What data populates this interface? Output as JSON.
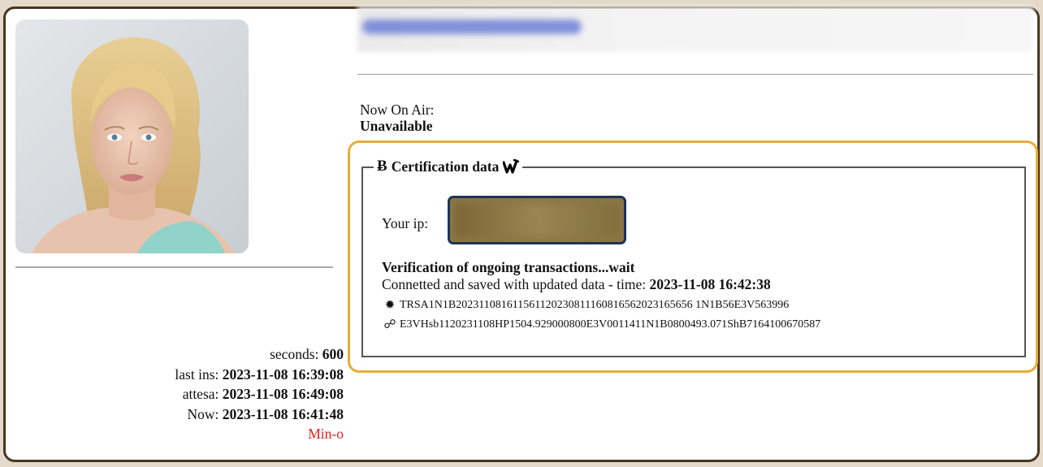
{
  "profile": {
    "photo_icon": "woman-portrait"
  },
  "header": {
    "blurred_link": ""
  },
  "on_air": {
    "label": "Now On Air:",
    "value": "Unavailable"
  },
  "certification": {
    "legend_prefix_icon": "bitcoin-icon",
    "legend_prefix_glyph": "Ƀ",
    "legend": "Certification data",
    "legend_suffix_icon": "brand-w-icon",
    "ip_label": "Your ip:",
    "ip_value": "",
    "status_title": "Verification of ongoing transactions...wait",
    "status_prefix": "Connetted and saved with updated data - time: ",
    "status_time": "2023-11-08 16:42:38",
    "code1_icon": "gear-icon",
    "code1_glyph": "✹",
    "code1": "TRSA1N1B202311081611561120230811160816562023165656 1N1B56E3V563996",
    "code2_icon": "link-icon",
    "code2_glyph": "☍",
    "code2": "E3VHsb1120231108HP1504.929000800E3V0011411N1B0800493.071ShB7164100670587"
  },
  "stats": {
    "seconds_label": "seconds: ",
    "seconds_value": "600",
    "last_ins_label": "last ins: ",
    "last_ins_value": "2023-11-08 16:39:08",
    "attesa_label": "attesa: ",
    "attesa_value": "2023-11-08 16:49:08",
    "now_label": "Now: ",
    "now_value": "2023-11-08 16:41:48",
    "mode": "Min-o",
    "mode_color": "#e8211f"
  },
  "colors": {
    "frame_border": "#4a3520",
    "highlight_border": "#e7ad36",
    "ip_box_border": "#1d3457"
  }
}
